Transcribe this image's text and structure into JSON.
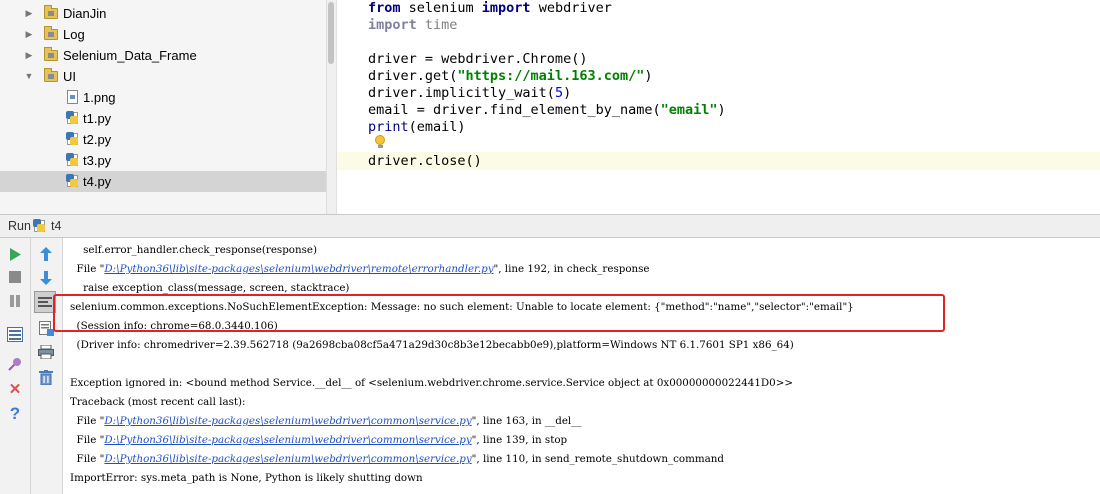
{
  "project_tree": {
    "items": [
      {
        "label": "DianJin",
        "kind": "folder",
        "expanded": false
      },
      {
        "label": "Log",
        "kind": "folder",
        "expanded": false
      },
      {
        "label": "Selenium_Data_Frame",
        "kind": "folder",
        "expanded": false
      },
      {
        "label": "UI",
        "kind": "folder",
        "expanded": true
      },
      {
        "label": "1.png",
        "kind": "png-file"
      },
      {
        "label": "t1.py",
        "kind": "py-file"
      },
      {
        "label": "t2.py",
        "kind": "py-file"
      },
      {
        "label": "t3.py",
        "kind": "py-file"
      },
      {
        "label": "t4.py",
        "kind": "py-file",
        "selected": true
      }
    ]
  },
  "editor": {
    "lines": [
      "from selenium import webdriver",
      "import time",
      "",
      "driver = webdriver.Chrome()",
      "driver.get(\"https://mail.163.com/\")",
      "driver.implicitly_wait(5)",
      "email = driver.find_element_by_name(\"email\")",
      "print(email)",
      "",
      "driver.close()"
    ]
  },
  "run_panel": {
    "label": "Run",
    "tab": "t4",
    "console_lines": [
      {
        "text": "    self.error_handler.check_response(response)"
      },
      {
        "prefix": "  File \"",
        "link": "D:\\Python36\\lib\\site-packages\\selenium\\webdriver\\remote\\errorhandler.py",
        "suffix": "\", line 192, in check_response"
      },
      {
        "text": "    raise exception_class(message, screen, stacktrace)"
      },
      {
        "text": "selenium.common.exceptions.NoSuchElementException: Message: no such element: Unable to locate element: {\"method\":\"name\",\"selector\":\"email\"}"
      },
      {
        "text": "  (Session info: chrome=68.0.3440.106)"
      },
      {
        "text": "  (Driver info: chromedriver=2.39.562718 (9a2698cba08cf5a471a29d30c8b3e12becabb0e9),platform=Windows NT 6.1.7601 SP1 x86_64)"
      },
      {
        "text": ""
      },
      {
        "text": "Exception ignored in: <bound method Service.__del__ of <selenium.webdriver.chrome.service.Service object at 0x00000000022441D0>>"
      },
      {
        "text": "Traceback (most recent call last):"
      },
      {
        "prefix": "  File \"",
        "link": "D:\\Python36\\lib\\site-packages\\selenium\\webdriver\\common\\service.py",
        "suffix": "\", line 163, in __del__"
      },
      {
        "prefix": "  File \"",
        "link": "D:\\Python36\\lib\\site-packages\\selenium\\webdriver\\common\\service.py",
        "suffix": "\", line 139, in stop"
      },
      {
        "prefix": "  File \"",
        "link": "D:\\Python36\\lib\\site-packages\\selenium\\webdriver\\common\\service.py",
        "suffix": "\", line 110, in send_remote_shutdown_command"
      },
      {
        "text": "ImportError: sys.meta_path is None, Python is likely shutting down"
      }
    ]
  },
  "colors": {
    "highlight_box": "#e02424",
    "link": "#1f4fc7",
    "keyword": "#000080",
    "string": "#008000"
  },
  "icons": {
    "toolbar_left": [
      "run-icon",
      "stop-icon",
      "pause-icon",
      "layout-icon",
      "pin-icon",
      "close-icon",
      "help-icon"
    ],
    "toolbar_right": [
      "up-arrow-icon",
      "down-arrow-icon",
      "soft-wrap-icon",
      "scroll-to-end-icon",
      "print-icon",
      "trash-icon"
    ]
  }
}
